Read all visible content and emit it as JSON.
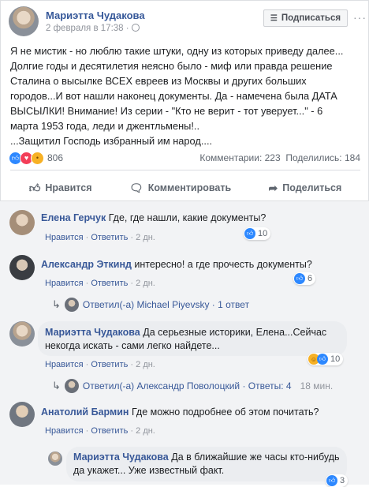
{
  "post": {
    "author": "Мариэтта Чудакова",
    "date": "2 февраля в 17:38 ·",
    "subscribe_label": "Подписаться",
    "more": "···",
    "lines": [
      "Я не мистик - но люблю такие штуки, одну из которых приведу далее...",
      "Долгие годы и десятилетия неясно было - миф или правда решение",
      "Сталина о высылке ВСЕХ евреев из Москвы и других больших",
      "городов...И вот нашли наконец документы. Да - намечена была ДАТА",
      "ВЫСЫЛКИ! Внимание! Из серии - \"Кто не верит - тот уверует...\" - 6",
      "марта 1953 года, леди и джентльмены!..",
      "...Защитил Господь избранный им народ...."
    ],
    "reaction_count": "806",
    "comments_stat": "Комментарии: 223",
    "shares_stat": "Поделились: 184",
    "actions": {
      "like": "Нравится",
      "comment": "Комментировать",
      "share": "Поделиться"
    }
  },
  "comments": [
    {
      "name": "Елена Герчук",
      "text": "Где, где нашли, какие документы?",
      "like": "Нравится",
      "reply": "Ответить",
      "time": "2 дн.",
      "count": "10"
    },
    {
      "name": "Александр Эткинд",
      "text": "интересно! а где прочесть документы?",
      "like": "Нравится",
      "reply": "Ответить",
      "time": "2 дн.",
      "count": "6",
      "replies": "Ответил(-а) Michael Piyevsky · 1 ответ"
    },
    {
      "name": "Мариэтта Чудакова",
      "text_line1": "Да серьезные историки, Елена...Сейчас",
      "text_line2": "некогда искать - сами легко найдете...",
      "like": "Нравится",
      "reply": "Ответить",
      "time": "2 дн.",
      "count": "10",
      "replies": "Ответил(-а) Александр Поволоцкий · Ответы: 4",
      "replies_time": "18 мин."
    },
    {
      "name": "Анатолий Бармин",
      "text": "Где можно подробнее об этом почитать?",
      "like": "Нравится",
      "reply": "Ответить",
      "time": "2 дн."
    }
  ],
  "nested_reply": {
    "name": "Мариэтта Чудакова",
    "text_line1": "Да в ближайшие же часы кто-нибудь",
    "text_line2": "да укажет... Уже известный факт.",
    "count": "3"
  },
  "colors": {
    "link": "#385898",
    "like_blue": "#2d88ff",
    "love_red": "#f33e58",
    "muted": "#90949c"
  }
}
